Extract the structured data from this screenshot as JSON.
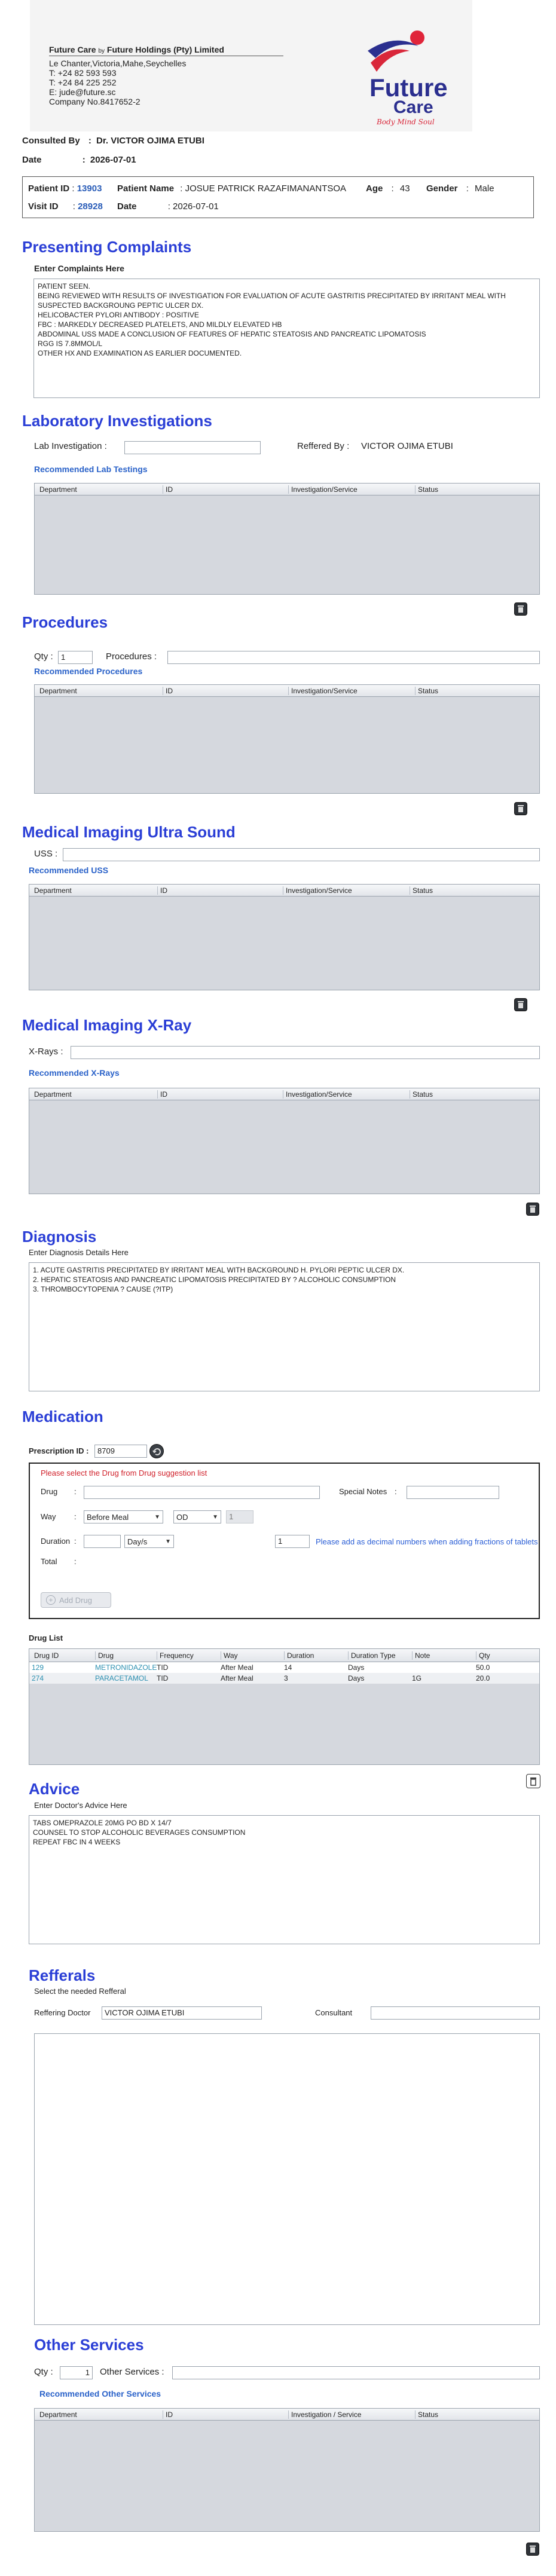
{
  "company": {
    "name": "Future Care",
    "by": "by",
    "holdings": "Future Holdings (Pty) Limited",
    "address": "Le Chanter,Victoria,Mahe,Seychelles",
    "tel": "T: +24  82 593 593",
    "tel2": "T: +24  84 225 252",
    "email": "E: jude@future.sc",
    "company_no": "Company No.8417652-2",
    "logo_text_1": "Future",
    "logo_text_2": "Care",
    "logo_tagline": "Body Mind Soul"
  },
  "consult": {
    "consulted_by_label": "Consulted By",
    "consulted_by_value": "Dr.  VICTOR OJIMA ETUBI",
    "date_label": "Date",
    "date_value": "2026-07-01"
  },
  "patient": {
    "id_label": "Patient ID",
    "id_value": "13903",
    "name_label": "Patient Name",
    "name_value": "JOSUE PATRICK RAZAFIMANANTSOA",
    "age_label": "Age",
    "age_value": "43",
    "gender_label": "Gender",
    "gender_value": "Male",
    "visit_label": "Visit ID",
    "visit_value": "28928",
    "date_label": "Date",
    "date_value": "2026-07-01"
  },
  "complaints": {
    "title": "Presenting Complaints",
    "subtitle": "Enter Complaints Here",
    "text": "PATIENT SEEN.\nBEING REVIEWED WITH RESULTS OF INVESTIGATION FOR EVALUATION OF ACUTE GASTRITIS PRECIPITATED BY IRRITANT MEAL WITH SUSPECTED BACKGROUNG PEPTIC ULCER DX.\nHELICOBACTER PYLORI ANTIBODY : POSITIVE\nFBC : MARKEDLY DECREASED PLATELETS, AND MILDLY ELEVATED HB\nABDOMINAL USS MADE A CONCLUSION OF FEATURES OF HEPATIC STEATOSIS AND PANCREATIC LIPOMATOSIS\nRGG IS 7.8MMOL/L\nOTHER HX AND EXAMINATION AS EARLIER DOCUMENTED."
  },
  "lab": {
    "title": "Laboratory  Investigations",
    "lab_label": "Lab Investigation :",
    "referred_label": "Reffered By :",
    "referred_value": "VICTOR OJIMA ETUBI",
    "recommended": "Recommended Lab Testings",
    "columns": [
      "Department",
      "ID",
      "Investigation/Service",
      "Status"
    ]
  },
  "procedures": {
    "title": "Procedures",
    "qty_label": "Qty :",
    "qty_value": "1",
    "proc_label": "Procedures :",
    "recommended": "Recommended Procedures",
    "columns": [
      "Department",
      "ID",
      "Investigation/Service",
      "Status"
    ]
  },
  "uss": {
    "title": "Medical Imaging Ultra Sound",
    "label": "USS :",
    "recommended": "Recommended USS",
    "columns": [
      "Department",
      "ID",
      "Investigation/Service",
      "Status"
    ]
  },
  "xray": {
    "title": "Medical Imaging X-Ray",
    "label": "X-Rays :",
    "recommended": "Recommended X-Rays",
    "columns": [
      "Department",
      "ID",
      "Investigation/Service",
      "Status"
    ]
  },
  "diagnosis": {
    "title": "Diagnosis",
    "subtitle": "Enter Diagnosis Details Here",
    "text": "1. ACUTE GASTRITIS PRECIPITATED BY IRRITANT MEAL WITH BACKGROUND H. PYLORI PEPTIC ULCER DX.\n2. HEPATIC STEATOSIS AND PANCREATIC LIPOMATOSIS PRECIPITATED BY ? ALCOHOLIC CONSUMPTION\n3. THROMBOCYTOPENIA ? CAUSE (?ITP)"
  },
  "medication": {
    "title": "Medication",
    "prescription_label": "Prescription ID :",
    "prescription_value": "8709",
    "warning": "Please select the Drug from Drug suggestion list",
    "drug_label": "Drug",
    "special_notes_label": "Special Notes",
    "way_label": "Way",
    "way_value": "Before Meal",
    "freq_value": "OD",
    "freq_qty": "1",
    "duration_label": "Duration",
    "duration_unit": "Day/s",
    "duration_qty": "1",
    "decimal_note": "Please add as decimal numbers when adding fractions of tablets (eg.:",
    "total_label": "Total",
    "add_button": "Add Drug",
    "drug_list_label": "Drug List",
    "drug_columns": [
      "Drug ID",
      "Drug",
      "Frequency",
      "Way",
      "Duration",
      "Duration Type",
      "Note",
      "Qty"
    ],
    "drugs": [
      {
        "id": "129",
        "name": "METRONIDAZOLE",
        "freq": "TID",
        "way": "After Meal",
        "duration": "14",
        "type": "Days",
        "note": "",
        "qty": "50.0"
      },
      {
        "id": "274",
        "name": "PARACETAMOL",
        "freq": "TID",
        "way": "After Meal",
        "duration": "3",
        "type": "Days",
        "note": "1G",
        "qty": "20.0"
      }
    ]
  },
  "advice": {
    "title": "Advice",
    "subtitle": "Enter Doctor's Advice Here",
    "text": "TABS OMEPRAZOLE 20MG PO BD X 14/7\nCOUNSEL TO STOP ALCOHOLIC BEVERAGES CONSUMPTION\nREPEAT FBC IN 4 WEEKS"
  },
  "referrals": {
    "title": "Refferals",
    "subtitle": "Select the needed Refferal",
    "doctor_label": "Reffering Doctor",
    "doctor_value": "VICTOR OJIMA ETUBI",
    "consultant_label": "Consultant"
  },
  "other": {
    "title": "Other Services",
    "qty_label": "Qty :",
    "qty_value": "1",
    "services_label": "Other Services :",
    "recommended": "Recommended Other Services",
    "columns": [
      "Department",
      "ID",
      "Investigation / Service",
      "Status"
    ]
  },
  "colors": {
    "section_title": "#2b3fd6",
    "link": "#2a62c9",
    "warning": "#d0202a",
    "grid_bg": "#d5d8de"
  },
  "icons": [
    "trash-icon",
    "refresh-icon",
    "plus-icon",
    "chevron-down-icon",
    "logo-swoosh-icon"
  ]
}
